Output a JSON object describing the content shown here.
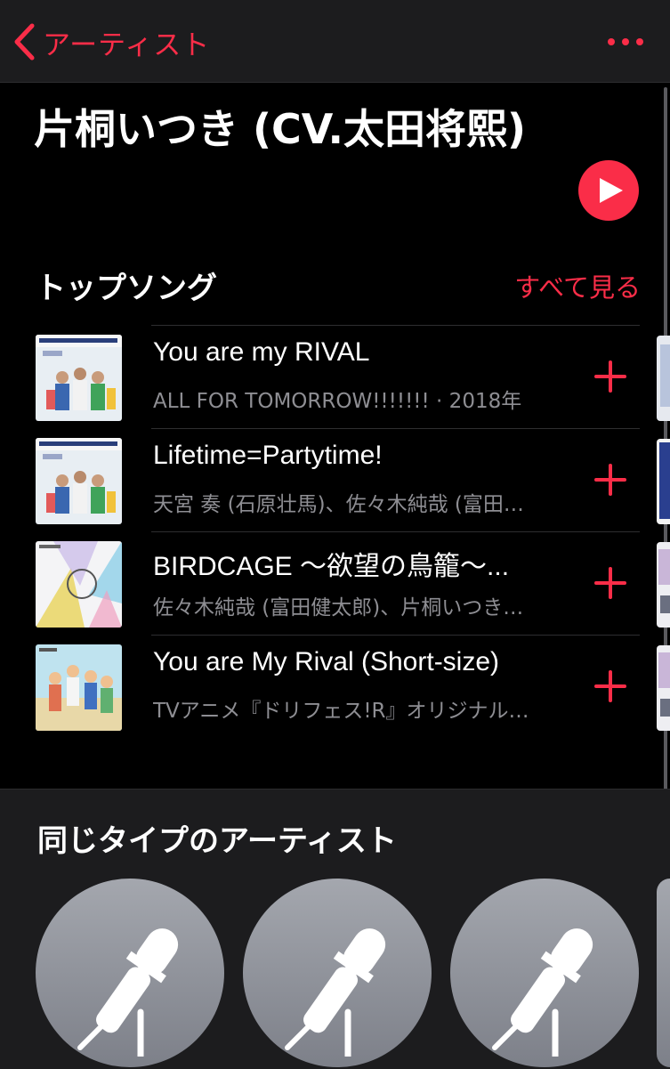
{
  "nav": {
    "back_label": "アーティスト"
  },
  "artist": {
    "name": "片桐いつき (CV.太田将熙)"
  },
  "top_songs": {
    "heading": "トップソング",
    "see_all": "すべて見る",
    "items": [
      {
        "title": "You are my RIVAL",
        "subtitle": "ALL FOR TOMORROW!!!!!!! · 2018年",
        "art": "all-for-tomorrow-cover"
      },
      {
        "title": "Lifetime=Partytime!",
        "subtitle": "天宮 奏 (石原壮馬)、佐々木純哉 (富田…",
        "art": "all-for-tomorrow-cover"
      },
      {
        "title": "BIRDCAGE 〜欲望の鳥籠〜...",
        "subtitle": "佐々木純哉 (富田健太郎)、片桐いつき…",
        "art": "shuffle-live-cover"
      },
      {
        "title": "You are My Rival (Short-size)",
        "subtitle": "TVアニメ『ドリフェス!R』オリジナル…",
        "art": "anime-cover"
      }
    ]
  },
  "similar": {
    "heading": "同じタイプのアーティスト",
    "placeholder_icon": "microphone-icon"
  },
  "colors": {
    "accent": "#fa2d48",
    "background": "#000000",
    "panel": "#1c1c1e",
    "secondary_text": "#8e8e93"
  }
}
